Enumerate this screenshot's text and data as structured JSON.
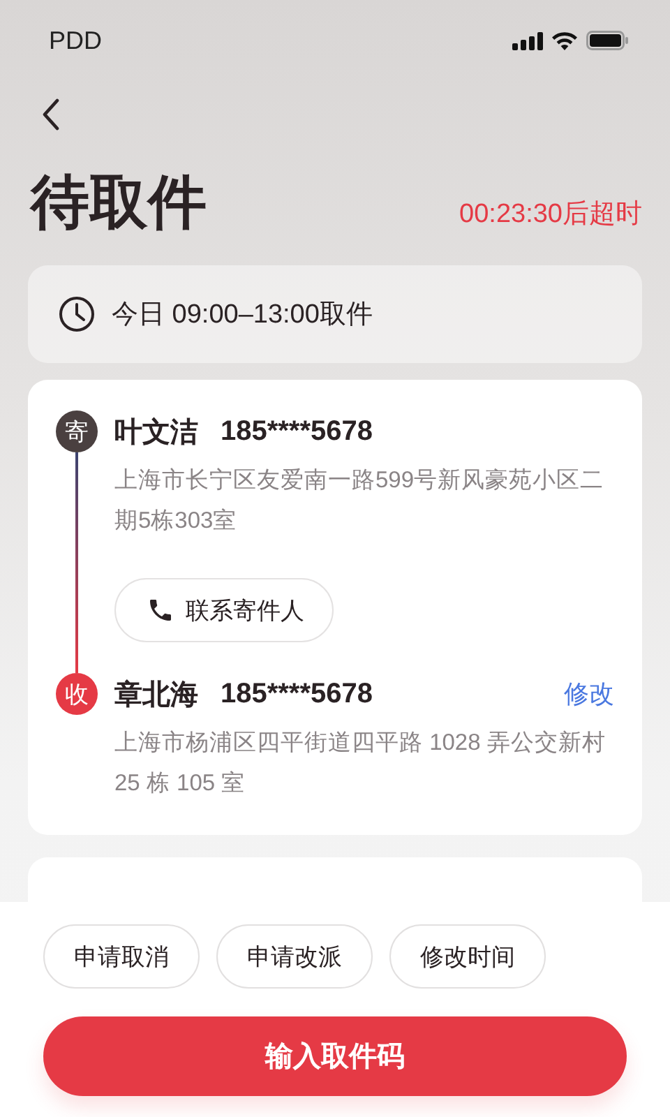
{
  "status_bar": {
    "carrier": "PDD"
  },
  "header": {
    "title": "待取件",
    "countdown": "00:23:30后超时"
  },
  "pickup_time": {
    "text": "今日 09:00–13:00取件"
  },
  "parties": [
    {
      "kind": "sender",
      "badge": "寄",
      "name": "叶文洁",
      "phone": "185****5678",
      "address": "上海市长宁区友爱南一路599号新风豪苑小区二期5栋303室",
      "action": "联系寄件人"
    },
    {
      "kind": "receiver",
      "badge": "收",
      "name": "章北海",
      "phone": "185****5678",
      "edit": "修改",
      "address": "上海市杨浦区四平街道四平路 1028 弄公交新村 25 栋 105 室"
    }
  ],
  "item_card": {
    "kind": "card"
  },
  "actions": [
    "申请取消",
    "申请改派",
    "修改时间"
  ],
  "primary_button": "输入取件码"
}
